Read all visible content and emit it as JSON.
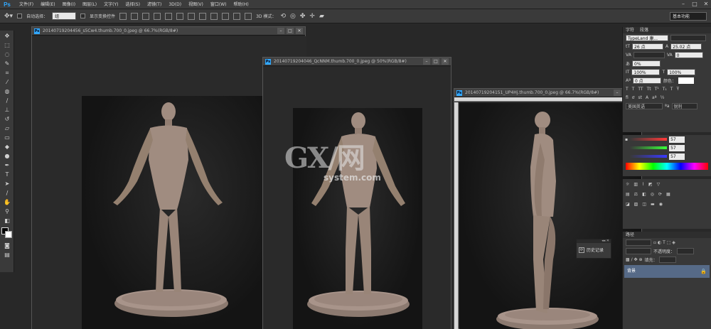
{
  "app": {
    "logo": "Ps"
  },
  "menu": [
    "文件(F)",
    "编辑(E)",
    "图像(I)",
    "图层(L)",
    "文字(Y)",
    "选择(S)",
    "滤镜(T)",
    "3D(D)",
    "视图(V)",
    "窗口(W)",
    "帮助(H)"
  ],
  "window_controls": [
    "–",
    "□",
    "✕"
  ],
  "options": {
    "auto_select_label": "自动选择：",
    "auto_select_value": "组",
    "show_transform_label": "显示变换控件",
    "mode_3d_label": "3D 模式：",
    "workspace": "基本功能"
  },
  "documents": [
    {
      "title": "20140719204456_s5Cw4.thumb.700_0.jpeg @ 66.7%(RGB/8#)"
    },
    {
      "title": "20140719204046_QcNNM.thumb.700_0.jpeg @ 50%(RGB/8#)"
    },
    {
      "title": "20140719204151_UP4Hj.thumb.700_0.jpeg @ 66.7%(RGB/8#)"
    }
  ],
  "doc_controls": [
    "–",
    "□",
    "✕"
  ],
  "character_panel": {
    "tabs": [
      "字符",
      "段落"
    ],
    "font_family": "TypeLand 康...",
    "font_size": "26 点",
    "leading": "25.02 点",
    "tracking": "0",
    "scale_pct": "0%",
    "vscale": "100%",
    "hscale": "100%",
    "baseline": "0 点",
    "color_label": "颜色：",
    "lang": "美国英语",
    "aa": "锐利"
  },
  "color_panel": {
    "r": "57",
    "g": "57",
    "b": "57"
  },
  "layers_panel": {
    "tab": "路径",
    "opacity_label": "不透明度：",
    "fill_label": "填充：",
    "layer_name": "背景"
  },
  "history_panel": {
    "label": "历史记录"
  },
  "watermark": {
    "main": "GX/网",
    "sub": "system.com"
  },
  "colors": {
    "accent": "#31a8ff",
    "layer_selected": "#566a87",
    "panel_bg": "#383838"
  }
}
